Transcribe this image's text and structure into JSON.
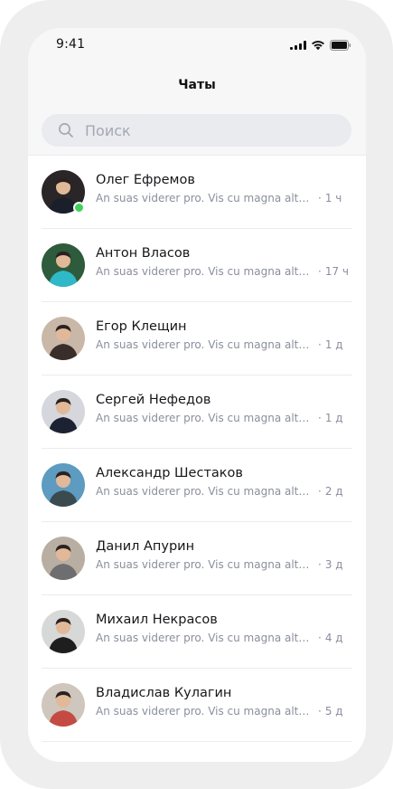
{
  "status_bar": {
    "time": "9:41"
  },
  "header": {
    "title": "Чаты"
  },
  "search": {
    "placeholder": "Поиск",
    "value": ""
  },
  "colors": {
    "accent_online": "#3fd15a",
    "secondary_text": "#8a8f9c"
  },
  "chats": [
    {
      "name": "Олег Ефремов",
      "preview": "An suas viderer pro. Vis cu magna altera",
      "separator": "·",
      "time": "1 ч",
      "online": true,
      "avatar_bg": "#2a2527",
      "avatar_fg": "#1a1f2c"
    },
    {
      "name": "Антон Власов",
      "preview": "An suas viderer pro. Vis cu magna altera",
      "separator": "·",
      "time": "17 ч",
      "online": false,
      "avatar_bg": "#2d5b3b",
      "avatar_fg": "#2fb8c8"
    },
    {
      "name": "Егор Клещин",
      "preview": "An suas viderer pro. Vis cu magna altera",
      "separator": "·",
      "time": "1 д",
      "online": false,
      "avatar_bg": "#c9b7a8",
      "avatar_fg": "#3a2e2a"
    },
    {
      "name": "Сергей Нефедов",
      "preview": "An suas viderer pro. Vis cu magna altera",
      "separator": "·",
      "time": "1 д",
      "online": false,
      "avatar_bg": "#d5d7dc",
      "avatar_fg": "#1d2233"
    },
    {
      "name": "Александр Шестаков",
      "preview": "An suas viderer pro. Vis cu magna altera",
      "separator": "·",
      "time": "2 д",
      "online": false,
      "avatar_bg": "#5d9bc0",
      "avatar_fg": "#3b4a4f"
    },
    {
      "name": "Данил Апурин",
      "preview": "An suas viderer pro. Vis cu magna altera",
      "separator": "·",
      "time": "3 д",
      "online": false,
      "avatar_bg": "#b9aea2",
      "avatar_fg": "#6e6e70"
    },
    {
      "name": "Михаил Некрасов",
      "preview": "An suas viderer pro. Vis cu magna altera",
      "separator": "·",
      "time": "4 д",
      "online": false,
      "avatar_bg": "#d7d8d8",
      "avatar_fg": "#1e1e1e"
    },
    {
      "name": "Владислав Кулагин",
      "preview": "An suas viderer pro. Vis cu magna altera",
      "separator": "·",
      "time": "5 д",
      "online": false,
      "avatar_bg": "#cfc6bd",
      "avatar_fg": "#c44b43"
    }
  ]
}
